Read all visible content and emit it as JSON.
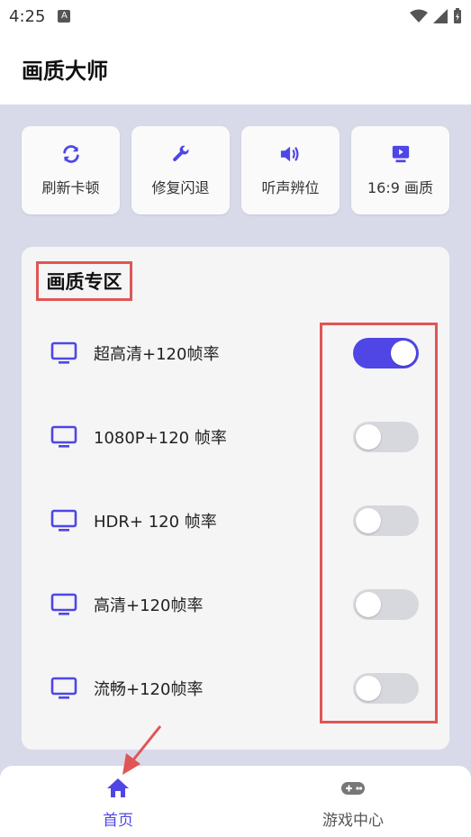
{
  "status_bar": {
    "time": "4:25",
    "notif_icon": "A"
  },
  "app": {
    "title": "画质大师"
  },
  "quick_actions": [
    {
      "label": "刷新卡顿",
      "icon": "refresh-icon"
    },
    {
      "label": "修复闪退",
      "icon": "wrench-icon"
    },
    {
      "label": "听声辨位",
      "icon": "speaker-icon"
    },
    {
      "label": "16:9 画质",
      "icon": "screen-play-icon"
    }
  ],
  "quality_section": {
    "title": "画质专区",
    "items": [
      {
        "label": "超高清+120帧率",
        "enabled": true
      },
      {
        "label": "1080P+120 帧率",
        "enabled": false
      },
      {
        "label": "HDR+ 120 帧率",
        "enabled": false
      },
      {
        "label": "高清+120帧率",
        "enabled": false
      },
      {
        "label": "流畅+120帧率",
        "enabled": false
      }
    ]
  },
  "bottom_nav": {
    "home": {
      "label": "首页",
      "icon": "home-icon",
      "active": true
    },
    "games": {
      "label": "游戏中心",
      "icon": "gamepad-icon",
      "active": false
    }
  },
  "colors": {
    "accent": "#4f46e5",
    "annotation": "#e05555",
    "background": "#d8daea"
  }
}
